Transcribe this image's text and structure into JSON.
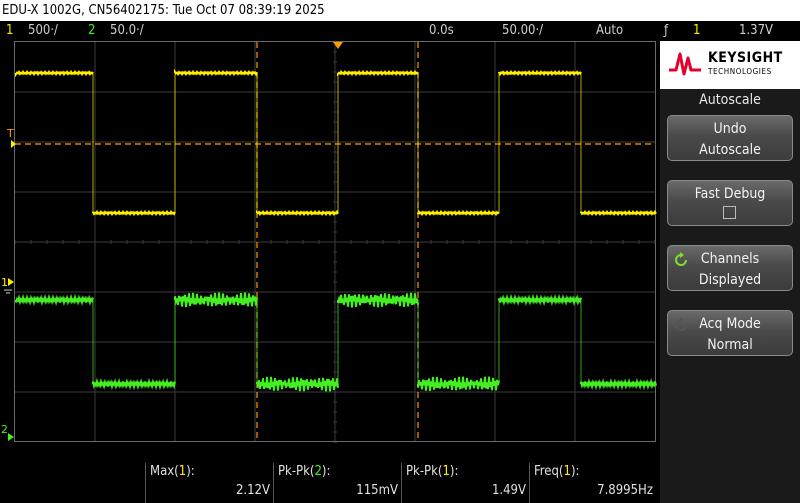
{
  "title": "EDU-X 1002G, CN56402175: Tue Oct 07 08:39:19 2025",
  "status": {
    "ch1_num": "1",
    "ch1_scale": "500‧/",
    "ch2_num": "2",
    "ch2_scale": "50.0‧/",
    "delay": "0.0s",
    "timebase": "50.00‧/",
    "trigger_mode": "Auto",
    "trigger_slope": "ƒ",
    "trigger_channel": "1",
    "trigger_level": "1.37V"
  },
  "colors": {
    "ch1": "#ffee00",
    "ch2": "#44ee22",
    "cursor": "#ff9900"
  },
  "plot_markers": {
    "trigger_level_marker": "T",
    "ch1_ground_marker": "1",
    "ch2_ground_marker": "2"
  },
  "panel": {
    "brand": "KEYSIGHT",
    "brand_sub": "TECHNOLOGIES",
    "heading": "Autoscale",
    "softkeys": [
      {
        "line1": "Undo",
        "line2": "Autoscale"
      },
      {
        "line1": "Fast Debug",
        "line2": ""
      },
      {
        "line1": "Channels",
        "line2": "Displayed"
      },
      {
        "line1": "Acq Mode",
        "line2": "Normal"
      }
    ]
  },
  "measurements": [
    {
      "label_prefix": "Max(",
      "channel": "1",
      "label_suffix": "):",
      "value": "2.12V"
    },
    {
      "label_prefix": "Pk-Pk(",
      "channel": "2",
      "label_suffix": "):",
      "value": "115mV"
    },
    {
      "label_prefix": "Pk-Pk(",
      "channel": "1",
      "label_suffix": "):",
      "value": "1.49V"
    },
    {
      "label_prefix": "Freq(",
      "channel": "1",
      "label_suffix": "):",
      "value": "7.8995Hz"
    }
  ]
}
